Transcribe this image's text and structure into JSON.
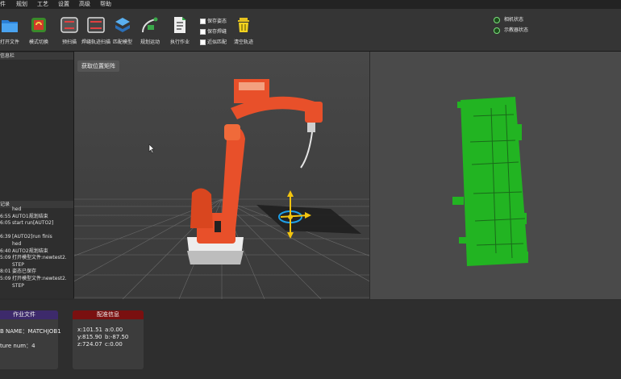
{
  "menu": [
    "件",
    "规划",
    "工艺",
    "设置",
    "高级",
    "帮助"
  ],
  "toolbar": {
    "buttons": [
      {
        "label": "打开文件",
        "icon": "folder-icon"
      },
      {
        "label": "模式切换",
        "icon": "mode-switch-icon"
      },
      {
        "label": "预扫描",
        "icon": "prescan-icon"
      },
      {
        "label": "焊缝轨迹扫描",
        "icon": "weld-scan-icon"
      },
      {
        "label": "匹配模型",
        "icon": "match-model-icon"
      },
      {
        "label": "规划运动",
        "icon": "plan-motion-icon"
      },
      {
        "label": "执行作业",
        "icon": "execute-job-icon"
      },
      {
        "label": "清空轨迹",
        "icon": "trash-icon"
      }
    ],
    "checkboxes": [
      "保存姿态",
      "保存焊缝",
      "近似匹配"
    ]
  },
  "status": [
    "相机状态",
    "示教器状态"
  ],
  "left_panel": {
    "info_title": "信息栏",
    "log_title": "记录",
    "log": [
      {
        "time": "",
        "msg": "hed"
      },
      {
        "time": "6:55",
        "msg": "AUTO1规划结束"
      },
      {
        "time": "6:05",
        "msg": "start run[AUTO2]"
      },
      {
        "time": "",
        "msg": ""
      },
      {
        "time": "6:39",
        "msg": "[AUTO2]run finis"
      },
      {
        "time": "",
        "msg": "hed"
      },
      {
        "time": "6:40",
        "msg": "AUTO2规划结束"
      },
      {
        "time": "5:09",
        "msg": "打开模型文件:newtest2."
      },
      {
        "time": "",
        "msg": "STEP"
      },
      {
        "time": "8:01",
        "msg": "姿态已保存"
      },
      {
        "time": "5:09",
        "msg": "打开模型文件:newtest2."
      },
      {
        "time": "",
        "msg": "STEP"
      }
    ]
  },
  "viewport": {
    "matrix_button": "获取位置矩阵"
  },
  "job_card": {
    "title": "作业文件",
    "line1": "B NAME：MATCHJOB1",
    "line2": "ture num：4"
  },
  "match_card": {
    "title": "配准信息",
    "rows": [
      [
        "x:101.51",
        "a:0.00"
      ],
      [
        "y:815.90",
        "b:-87.50"
      ],
      [
        "z:724.07",
        "c:0.00"
      ]
    ]
  },
  "colors": {
    "robot": "#e8502a",
    "pointcloud": "#22b422",
    "job_header": "#3d2a6b",
    "match_header": "#7a1010"
  }
}
